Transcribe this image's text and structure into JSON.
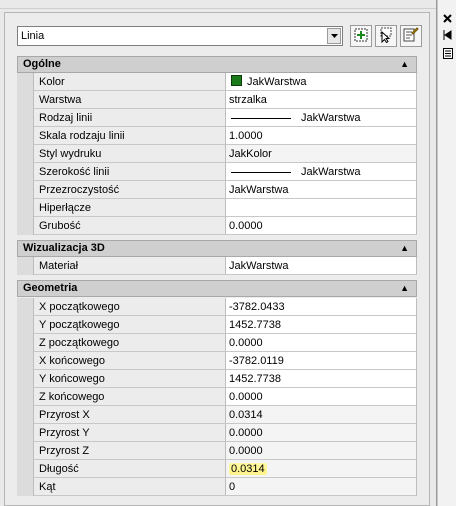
{
  "selector": {
    "value": "Linia"
  },
  "sections": {
    "general": {
      "title": "Ogólne",
      "rows": [
        {
          "label": "Kolor",
          "value": "JakWarstwa"
        },
        {
          "label": "Warstwa",
          "value": "strzalka"
        },
        {
          "label": "Rodzaj linii",
          "value": "JakWarstwa"
        },
        {
          "label": "Skala rodzaju linii",
          "value": "1.0000"
        },
        {
          "label": "Styl wydruku",
          "value": "JakKolor"
        },
        {
          "label": "Szerokość linii",
          "value": "JakWarstwa"
        },
        {
          "label": "Przezroczystość",
          "value": "JakWarstwa"
        },
        {
          "label": "Hiperłącze",
          "value": ""
        },
        {
          "label": "Grubość",
          "value": "0.0000"
        }
      ]
    },
    "viz3d": {
      "title": "Wizualizacja 3D",
      "rows": [
        {
          "label": "Materiał",
          "value": "JakWarstwa"
        }
      ]
    },
    "geometry": {
      "title": "Geometria",
      "rows": [
        {
          "label": "X początkowego",
          "value": "-3782.0433"
        },
        {
          "label": "Y początkowego",
          "value": "1452.7738"
        },
        {
          "label": "Z początkowego",
          "value": "0.0000"
        },
        {
          "label": "X końcowego",
          "value": "-3782.0119"
        },
        {
          "label": "Y końcowego",
          "value": "1452.7738"
        },
        {
          "label": "Z końcowego",
          "value": "0.0000"
        },
        {
          "label": "Przyrost X",
          "value": "0.0314"
        },
        {
          "label": "Przyrost Y",
          "value": "0.0000"
        },
        {
          "label": "Przyrost Z",
          "value": "0.0000"
        },
        {
          "label": "Długość",
          "value": "0.0314"
        },
        {
          "label": "Kąt",
          "value": "0"
        }
      ]
    }
  },
  "colors": {
    "color_swatch": "#1a7a1a",
    "highlight": "#fff48a"
  },
  "icons": {
    "sidebar": [
      "close-icon",
      "auto-hide-icon",
      "properties-menu-icon"
    ],
    "toolbar": [
      "toggle-pickadd-icon",
      "select-objects-icon",
      "quick-select-icon"
    ]
  }
}
